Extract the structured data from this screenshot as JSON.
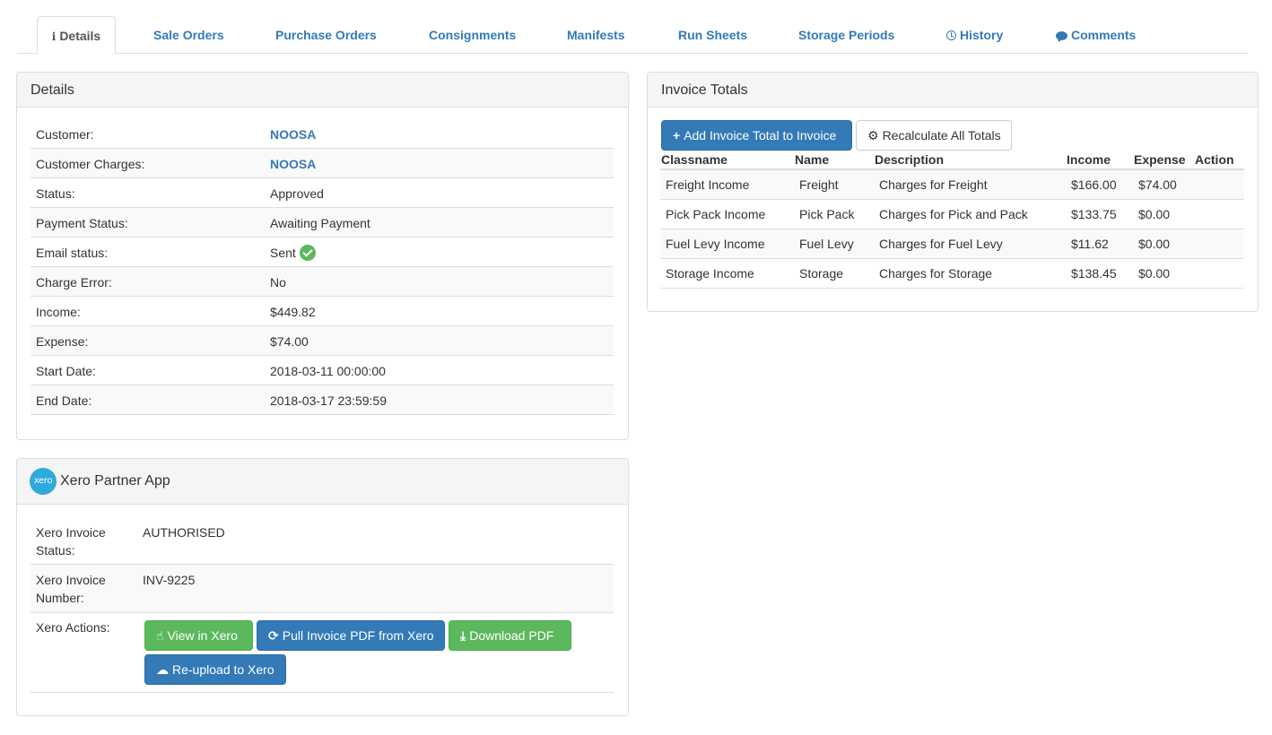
{
  "tabs": [
    {
      "label": "Details",
      "icon": "info-icon"
    },
    {
      "label": "Sale Orders"
    },
    {
      "label": "Purchase Orders"
    },
    {
      "label": "Consignments"
    },
    {
      "label": "Manifests"
    },
    {
      "label": "Run Sheets"
    },
    {
      "label": "Storage Periods"
    },
    {
      "label": "History",
      "icon": "clock-icon"
    },
    {
      "label": "Comments",
      "icon": "comment-icon"
    }
  ],
  "details": {
    "title": "Details",
    "rows": [
      {
        "key": "Customer:",
        "value": "NOOSA"
      },
      {
        "key": "Customer Charges:",
        "value": "NOOSA"
      },
      {
        "key": "Status:",
        "value": "Approved"
      },
      {
        "key": "Payment Status:",
        "value": "Awaiting Payment"
      },
      {
        "key": "Email status:",
        "value": "Sent"
      },
      {
        "key": "Charge Error:",
        "value": "No"
      },
      {
        "key": "Income:",
        "value": "$449.82"
      },
      {
        "key": "Expense:",
        "value": "$74.00"
      },
      {
        "key": "Start Date:",
        "value": "2018-03-11 00:00:00"
      },
      {
        "key": "End Date:",
        "value": "2018-03-17 23:59:59"
      }
    ]
  },
  "xero": {
    "logo_text": "xero",
    "title": "Xero Partner App",
    "invoice_status_label": "Xero Invoice Status:",
    "invoice_status": "AUTHORISED",
    "invoice_number_label": "Xero Invoice Number:",
    "invoice_number": "INV-9225",
    "actions_label": "Xero Actions:",
    "buttons": {
      "view": "View in Xero",
      "pull": "Pull Invoice PDF from Xero",
      "download": "Download PDF",
      "reupload": "Re-upload to Xero"
    }
  },
  "invoice_totals": {
    "title": "Invoice Totals",
    "add_button": "Add Invoice Total to Invoice",
    "recalc_button": "Recalculate All Totals",
    "columns": [
      "Classname",
      "Name",
      "Description",
      "Income",
      "Expense",
      "Action"
    ],
    "rows": [
      {
        "classname": "Freight Income",
        "name": "Freight",
        "description": "Charges for Freight",
        "income": "$166.00",
        "expense": "$74.00"
      },
      {
        "classname": "Pick Pack Income",
        "name": "Pick Pack",
        "description": "Charges for Pick and Pack",
        "income": "$133.75",
        "expense": "$0.00"
      },
      {
        "classname": "Fuel Levy Income",
        "name": "Fuel Levy",
        "description": "Charges for Fuel Levy",
        "income": "$11.62",
        "expense": "$0.00"
      },
      {
        "classname": "Storage Income",
        "name": "Storage",
        "description": "Charges for Storage",
        "income": "$138.45",
        "expense": "$0.00"
      }
    ]
  },
  "colors": {
    "link": "#337ab7",
    "success": "#5cb85c",
    "primary": "#337ab7",
    "xero_brand": "#2eaadc"
  }
}
